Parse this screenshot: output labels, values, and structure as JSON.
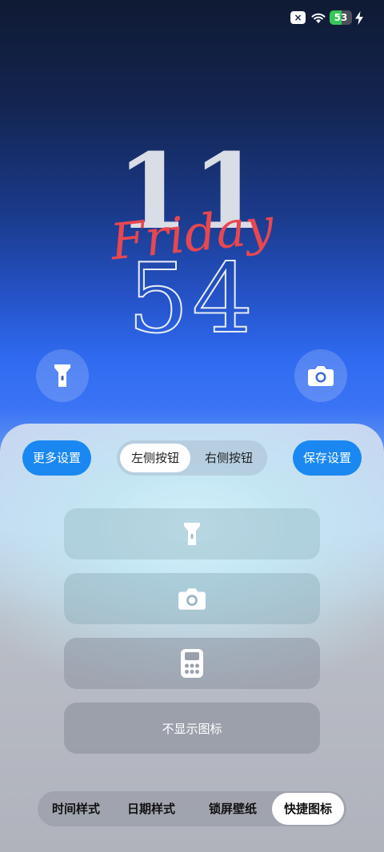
{
  "status_bar": {
    "close_badge": "×",
    "battery_level": "53",
    "battery_fraction": 0.53,
    "charging": true
  },
  "clock": {
    "hour": "11",
    "minute": "54",
    "day": "Friday",
    "day_color": "#e8474f"
  },
  "shortcuts": {
    "left_icon": "flashlight-icon",
    "right_icon": "camera-icon"
  },
  "panel": {
    "more_settings": "更多设置",
    "save_settings": "保存设置",
    "segments": [
      "左侧按钮",
      "右侧按钮"
    ],
    "active_segment": 0,
    "options": [
      {
        "icon": "flashlight-icon"
      },
      {
        "icon": "camera-icon"
      },
      {
        "icon": "calculator-icon"
      },
      {
        "label": "不显示图标"
      }
    ],
    "accent_color": "#1a88f0"
  },
  "tabs": [
    "时间样式",
    "日期样式",
    "锁屏壁纸",
    "快捷图标"
  ],
  "active_tab": 3
}
